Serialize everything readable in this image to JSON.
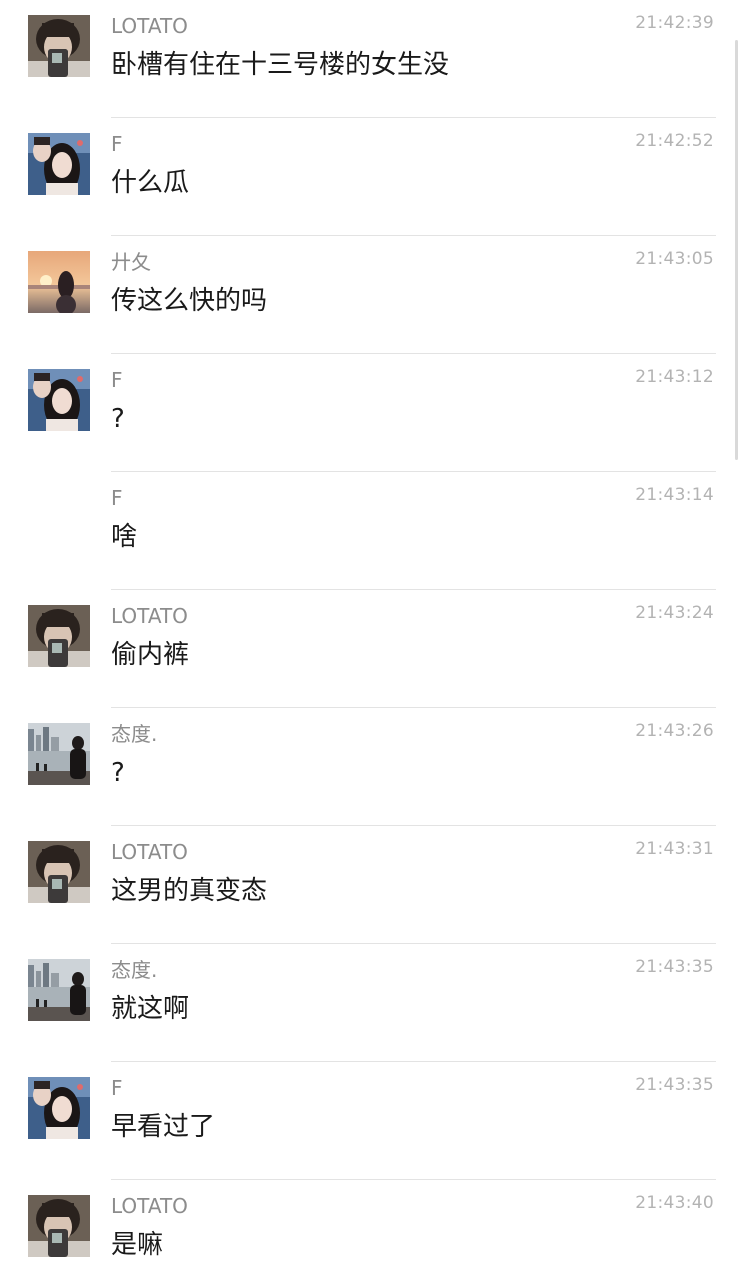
{
  "messages": [
    {
      "avatar": "boy-phone-avatar",
      "name": "LOTATO",
      "time": "21:42:39",
      "text": "卧槽有住在十三号楼的女生没"
    },
    {
      "avatar": "girl-selfie-avatar",
      "name": "F",
      "time": "21:42:52",
      "text": "什么瓜"
    },
    {
      "avatar": "sunset-girl-avatar",
      "name": "廾夂",
      "time": "21:43:05",
      "text": "传这么快的吗"
    },
    {
      "avatar": "girl-selfie-avatar",
      "name": "F",
      "time": "21:43:12",
      "text": "?"
    },
    {
      "avatar": "",
      "name": "F",
      "time": "21:43:14",
      "text": "啥"
    },
    {
      "avatar": "boy-phone-avatar",
      "name": "LOTATO",
      "time": "21:43:24",
      "text": "偷内裤"
    },
    {
      "avatar": "city-river-avatar",
      "name": "态度.",
      "time": "21:43:26",
      "text": "?"
    },
    {
      "avatar": "boy-phone-avatar",
      "name": "LOTATO",
      "time": "21:43:31",
      "text": "这男的真变态"
    },
    {
      "avatar": "city-river-avatar",
      "name": "态度.",
      "time": "21:43:35",
      "text": "就这啊"
    },
    {
      "avatar": "girl-selfie-avatar",
      "name": "F",
      "time": "21:43:35",
      "text": "早看过了"
    },
    {
      "avatar": "boy-phone-avatar",
      "name": "LOTATO",
      "time": "21:43:40",
      "text": "是嘛"
    }
  ],
  "colors": {
    "name": "#8c8c8c",
    "time": "#b3b3b3",
    "text": "#1a1a1a",
    "separator": "#e3e3e3"
  }
}
